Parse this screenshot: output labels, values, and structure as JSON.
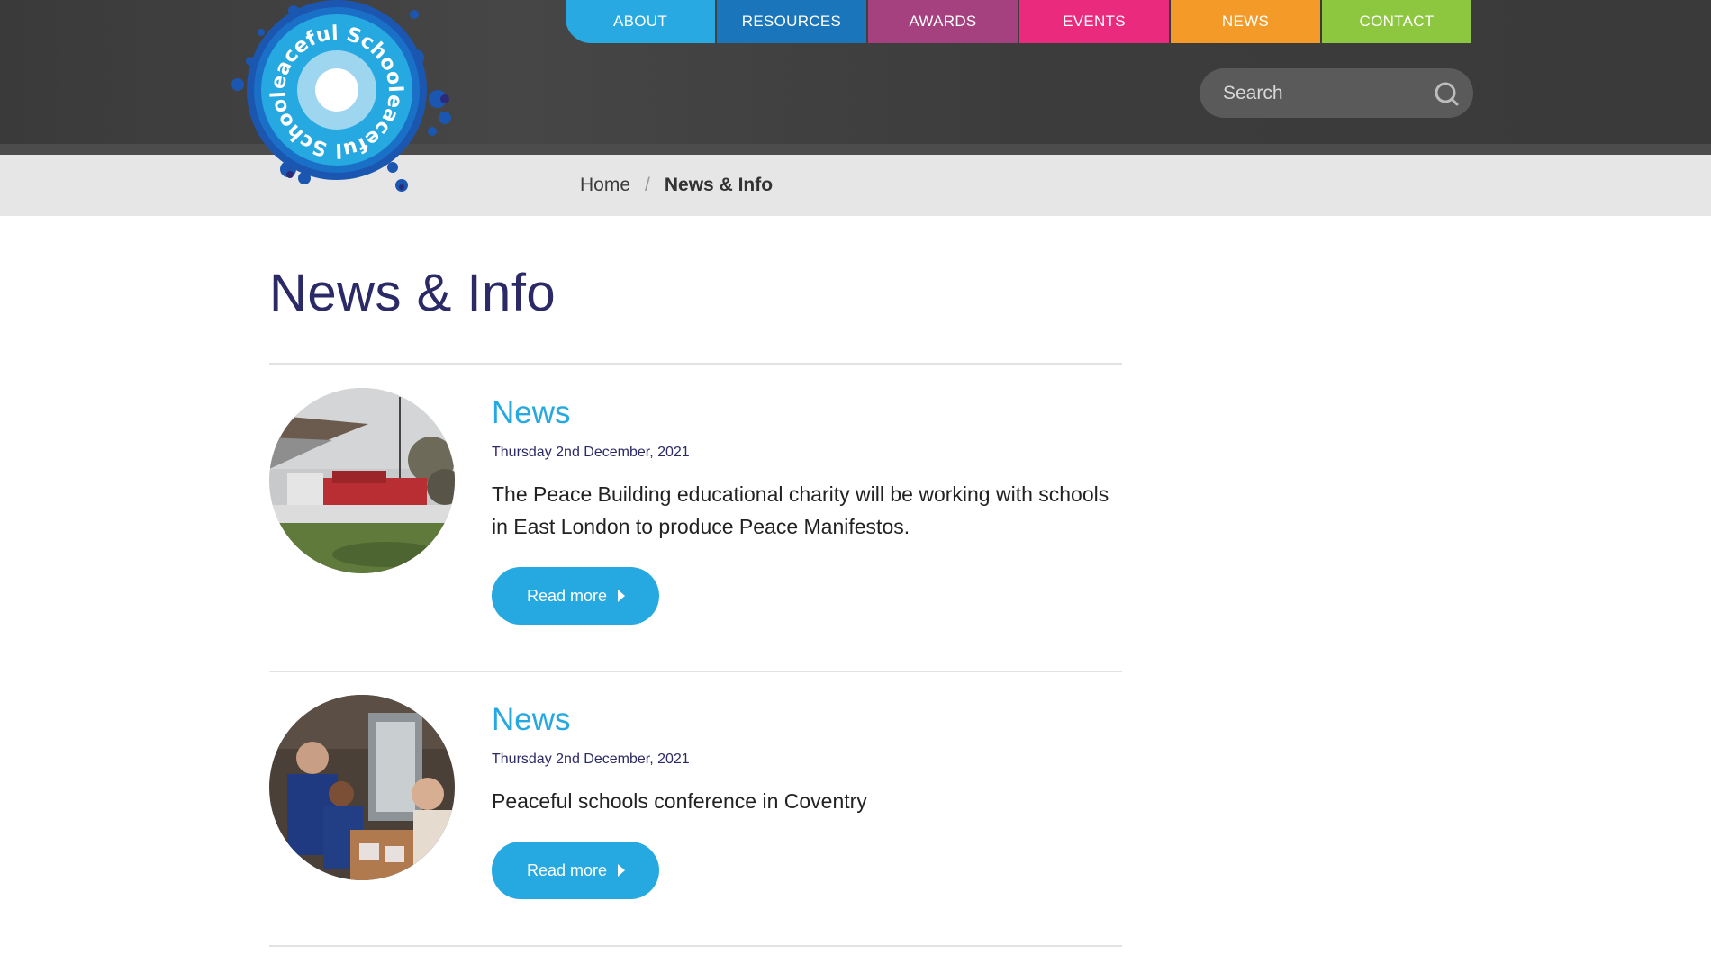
{
  "nav": {
    "items": [
      {
        "label": "ABOUT",
        "color": "#29a9e1"
      },
      {
        "label": "RESOURCES",
        "color": "#1b75bb"
      },
      {
        "label": "AWARDS",
        "color": "#a4417e"
      },
      {
        "label": "EVENTS",
        "color": "#ea2a7c"
      },
      {
        "label": "NEWS",
        "color": "#f39a29"
      },
      {
        "label": "CONTACT",
        "color": "#8dc63f"
      }
    ]
  },
  "logo": {
    "text_top": "Peaceful Schools",
    "text_bottom": "Peaceful Schools"
  },
  "search": {
    "placeholder": "Search",
    "icon": "search-icon"
  },
  "breadcrumb": {
    "home": "Home",
    "separator": "/",
    "current": "News & Info"
  },
  "page": {
    "title": "News & Info"
  },
  "articles": [
    {
      "category": "News",
      "date": "Thursday 2nd December, 2021",
      "summary": "The Peace Building educational charity will be working with schools in East London to produce Peace Manifestos.",
      "button": "Read more"
    },
    {
      "category": "News",
      "date": "Thursday 2nd December, 2021",
      "summary": "Peaceful schools conference in Coventry",
      "button": "Read more"
    }
  ],
  "colors": {
    "title": "#2b2966",
    "accent": "#26a8e0",
    "header": "#3a3a3a"
  }
}
